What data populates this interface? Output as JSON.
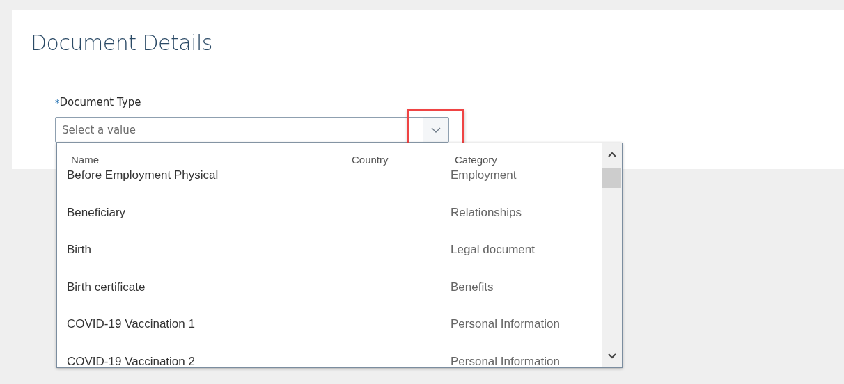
{
  "page": {
    "title": "Document Details"
  },
  "field": {
    "label": "Document Type",
    "required_mark": "*",
    "placeholder": "Select a value",
    "expanded": true
  },
  "dropdown": {
    "columns": [
      "Name",
      "Country",
      "Category"
    ],
    "rows": [
      {
        "name": "Before Employment Physical",
        "country": "",
        "category": "Employment"
      },
      {
        "name": "Beneficiary",
        "country": "",
        "category": "Relationships"
      },
      {
        "name": "Birth",
        "country": "",
        "category": "Legal document"
      },
      {
        "name": "Birth certificate",
        "country": "",
        "category": "Benefits"
      },
      {
        "name": "COVID-19 Vaccination 1",
        "country": "",
        "category": "Personal Information"
      },
      {
        "name": "COVID-19 Vaccination 2",
        "country": "",
        "category": "Personal Information"
      }
    ]
  }
}
